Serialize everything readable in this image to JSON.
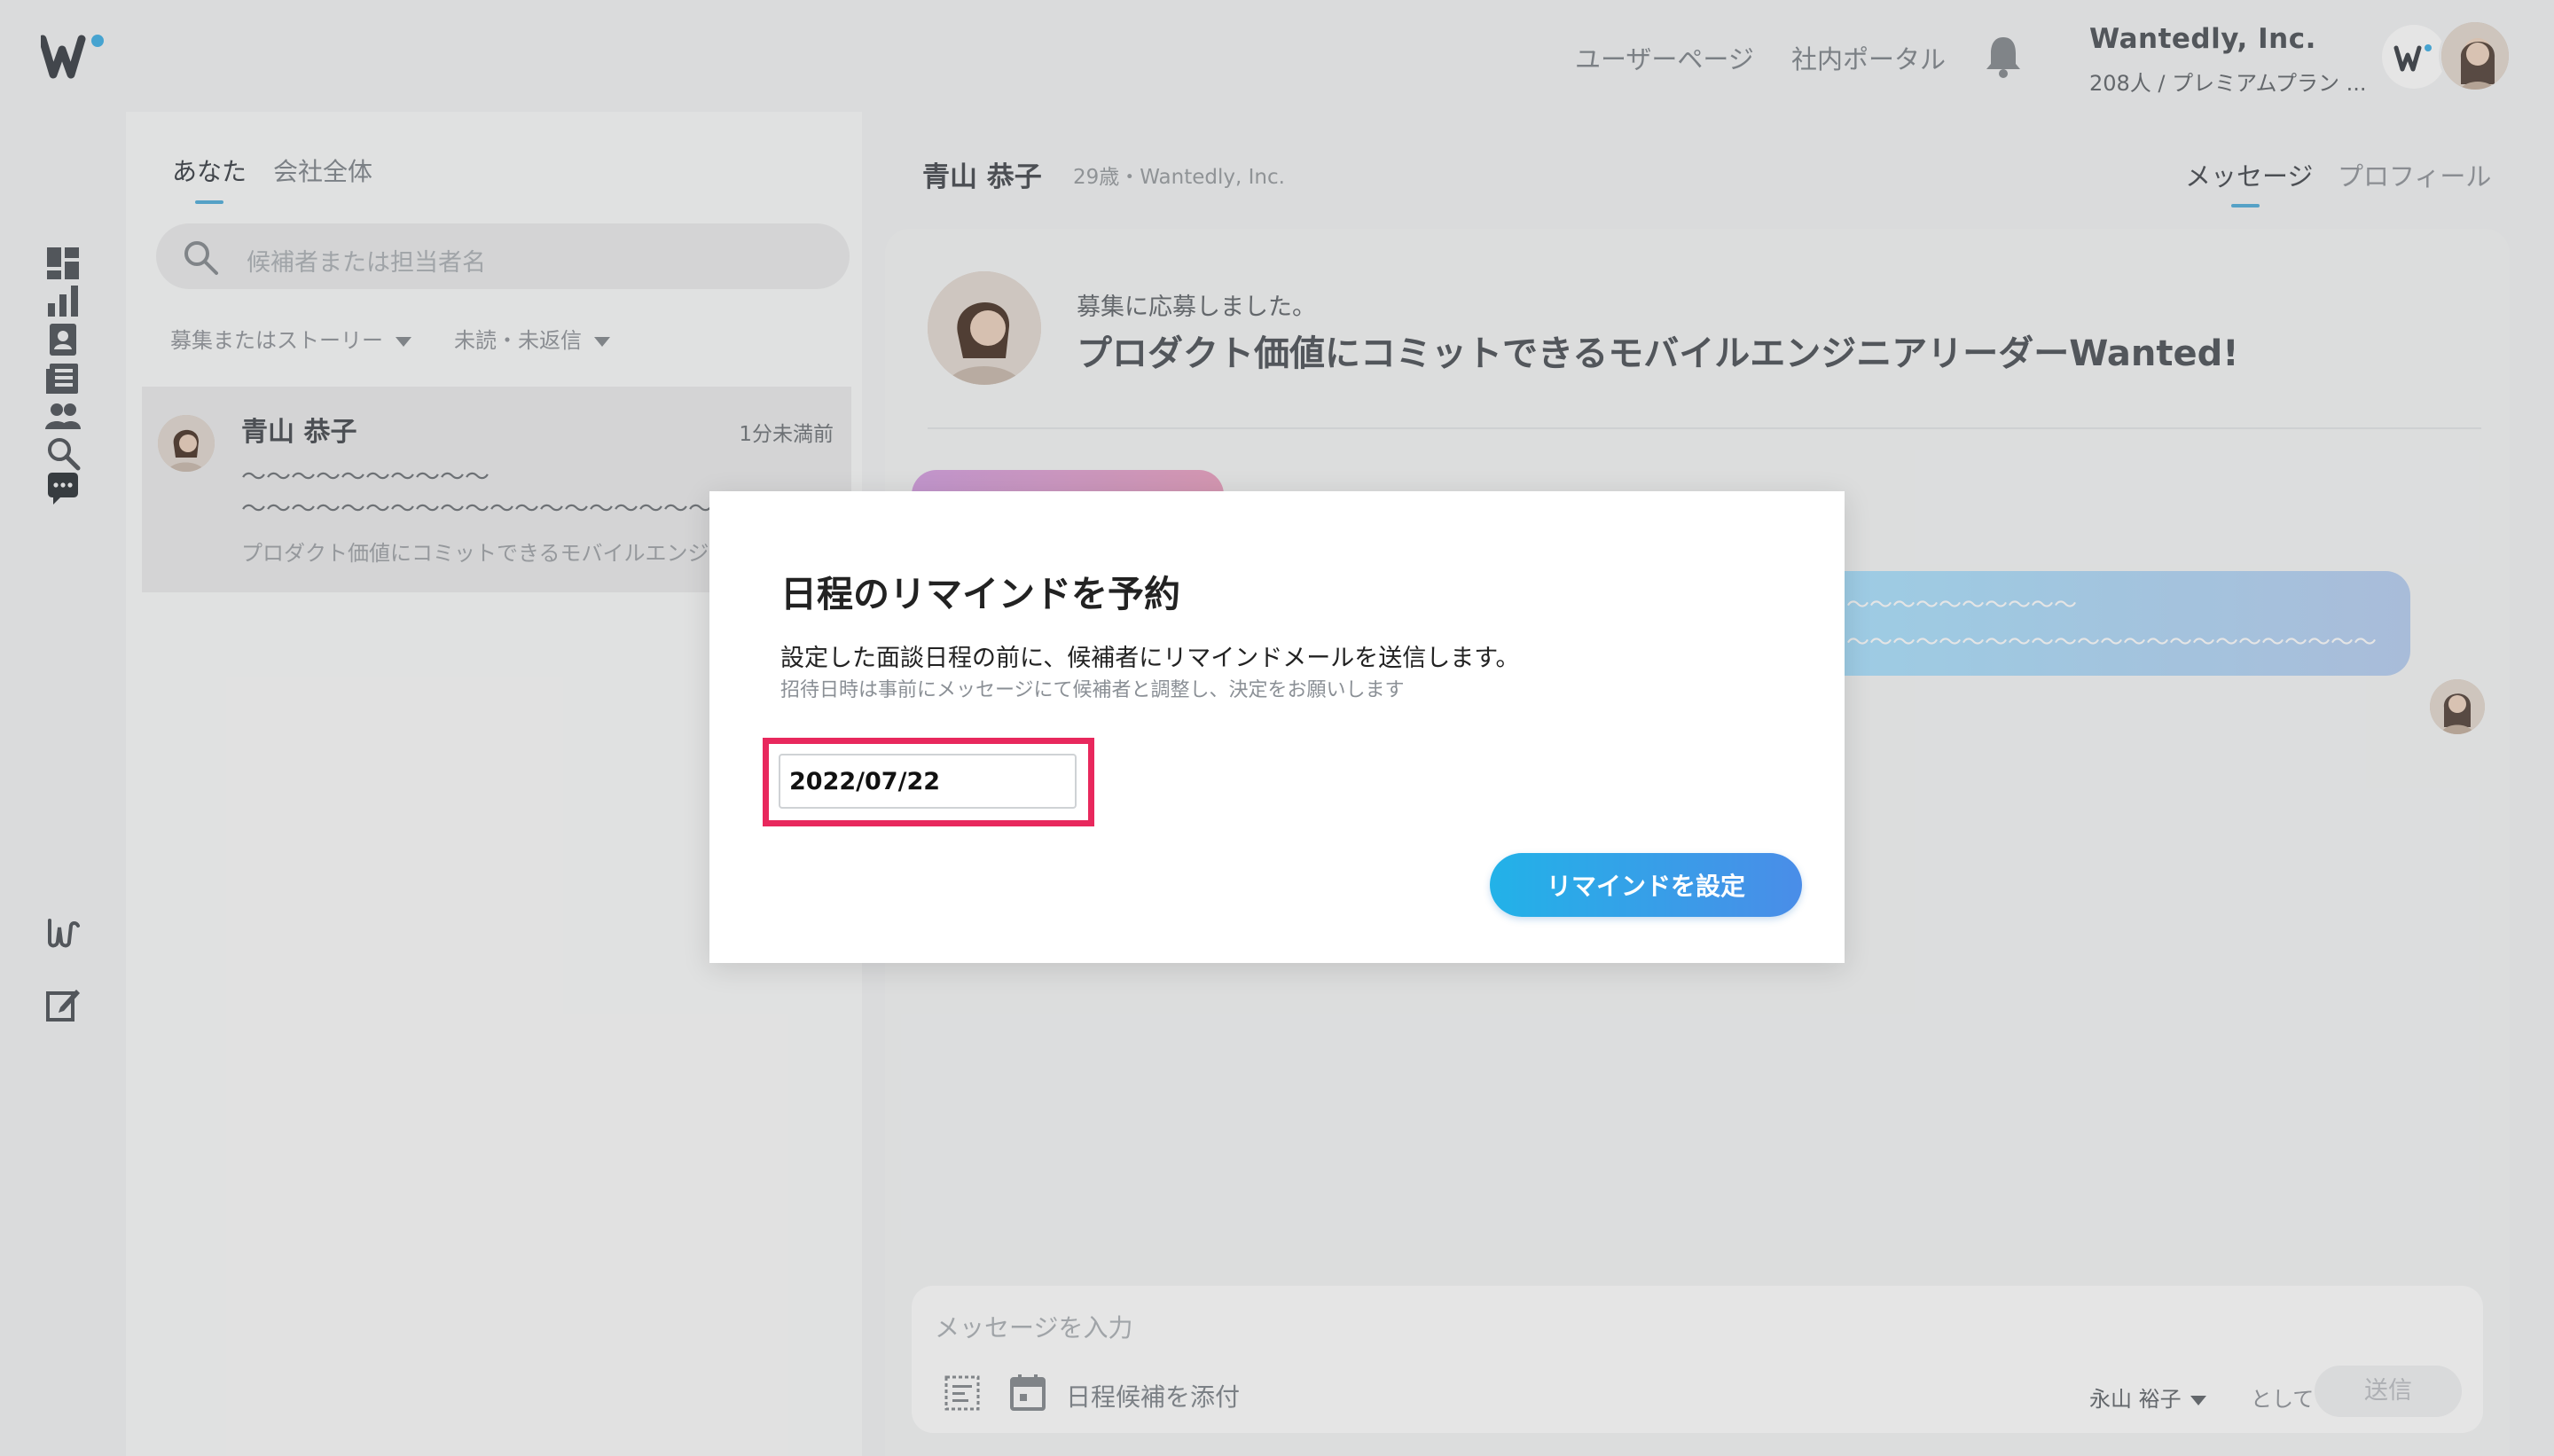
{
  "header": {
    "user_page": "ユーザーページ",
    "portal": "社内ポータル",
    "company_name": "Wantedly, Inc.",
    "company_plan": "208人 / プレミアムプラン ..."
  },
  "list": {
    "tabs": [
      "あなた",
      "会社全体"
    ],
    "search_placeholder": "候補者または担当者名",
    "filters": [
      "募集またはストーリー",
      "未読・未返信"
    ],
    "conversation": {
      "name": "青山 恭子",
      "time": "1分未満前",
      "line1": "〜〜〜〜〜〜〜〜〜〜",
      "line2": "〜〜〜〜〜〜〜〜〜〜〜〜〜〜〜〜〜〜〜〜",
      "subject": "プロダクト価値にコミットできるモバイルエンジ..."
    }
  },
  "detail": {
    "name": "青山 恭子",
    "meta": "29歳・Wantedly, Inc.",
    "tabs": [
      "メッセージ",
      "プロフィール"
    ],
    "apply_label": "募集に応募しました。",
    "apply_title": "プロダクト価値にコミットできるモバイルエンジニアリーダーWanted!",
    "bubble_line1": "〜〜〜〜〜〜〜〜〜〜",
    "bubble_line2": "〜〜〜〜〜〜〜〜〜〜〜〜〜〜〜〜〜〜〜〜〜〜〜",
    "composer_placeholder": "メッセージを入力",
    "attach_schedule": "日程候補を添付",
    "sender": "永山 裕子",
    "as": "として",
    "send": "送信"
  },
  "modal": {
    "title": "日程のリマインドを予約",
    "description": "設定した面談日程の前に、候補者にリマインドメールを送信します。",
    "note": "招待日時は事前にメッセージにて候補者と調整し、決定をお願いします",
    "date_value": "2022/07/22",
    "submit": "リマインドを設定"
  },
  "colors": {
    "accent": "#5fb4dd",
    "highlight": "#e8285d",
    "button_start": "#22b2e8",
    "button_end": "#4a8de8"
  },
  "icons": [
    "wantedly-logo-icon",
    "bell-icon",
    "dashboard-icon",
    "analytics-icon",
    "candidate-icon",
    "stories-icon",
    "team-icon",
    "search-icon",
    "chat-icon",
    "engage-icon",
    "compose-icon",
    "template-icon",
    "calendar-icon"
  ]
}
